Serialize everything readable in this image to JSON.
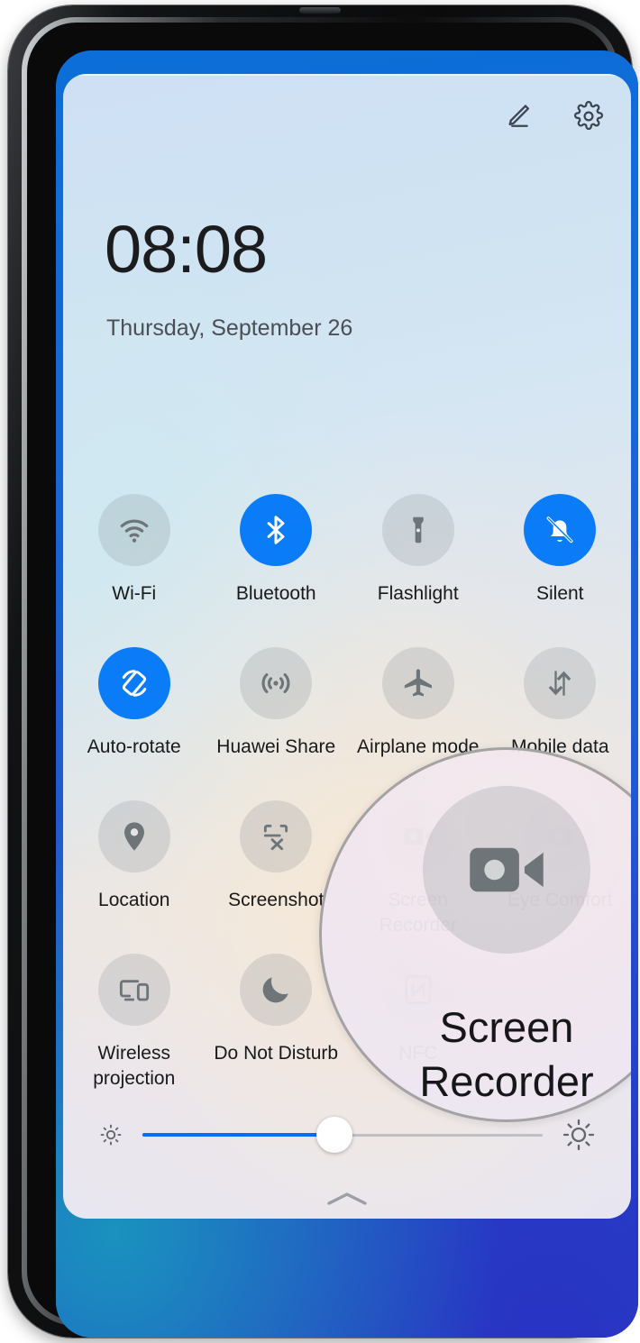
{
  "device": {
    "frame": "huawei-phone"
  },
  "statusbar": {
    "time": "08:08",
    "date": "Thursday, September 26"
  },
  "panel": {
    "edit_label": "Edit",
    "settings_label": "Settings"
  },
  "toggles": [
    {
      "label": "Wi-Fi",
      "icon": "wifi-icon",
      "state": "off"
    },
    {
      "label": "Bluetooth",
      "icon": "bluetooth-icon",
      "state": "on"
    },
    {
      "label": "Flashlight",
      "icon": "flashlight-icon",
      "state": "off"
    },
    {
      "label": "Silent",
      "icon": "bell-off-icon",
      "state": "on"
    },
    {
      "label": "Auto-rotate",
      "icon": "auto-rotate-icon",
      "state": "on"
    },
    {
      "label": "Huawei Share",
      "icon": "huawei-share-icon",
      "state": "off"
    },
    {
      "label": "Airplane mode",
      "icon": "airplane-icon",
      "state": "off"
    },
    {
      "label": "Mobile data",
      "icon": "mobile-data-icon",
      "state": "off"
    },
    {
      "label": "Location",
      "icon": "location-pin-icon",
      "state": "off"
    },
    {
      "label": "Screenshot",
      "icon": "screenshot-icon",
      "state": "off"
    },
    {
      "label": "Screen Recorder",
      "icon": "screen-recorder-icon",
      "state": "off"
    },
    {
      "label": "Eye Comfort",
      "icon": "eye-comfort-icon",
      "state": "off"
    },
    {
      "label": "Wireless projection",
      "icon": "wireless-projection-icon",
      "state": "off"
    },
    {
      "label": "Do Not Disturb",
      "icon": "moon-icon",
      "state": "off"
    },
    {
      "label": "NFC",
      "icon": "nfc-icon",
      "state": "off"
    },
    {
      "label": "",
      "icon": "blank-icon",
      "state": "off"
    }
  ],
  "brightness": {
    "value_percent": 48,
    "low_icon": "brightness-low-icon",
    "high_icon": "brightness-high-icon"
  },
  "collapse_handle": {
    "icon": "chevron-up-icon"
  },
  "magnifier": {
    "icon": "screen-recorder-icon",
    "line1": "Screen",
    "line2": "Recorder"
  },
  "colors": {
    "accent_blue": "#0a7cf8",
    "slider_blue": "#0a6bf5",
    "tile_off_bg": "rgba(120,130,135,0.20)",
    "label_text": "#18191b",
    "date_text": "#4b4f55",
    "wallpaper_blue": "#1668d6"
  }
}
